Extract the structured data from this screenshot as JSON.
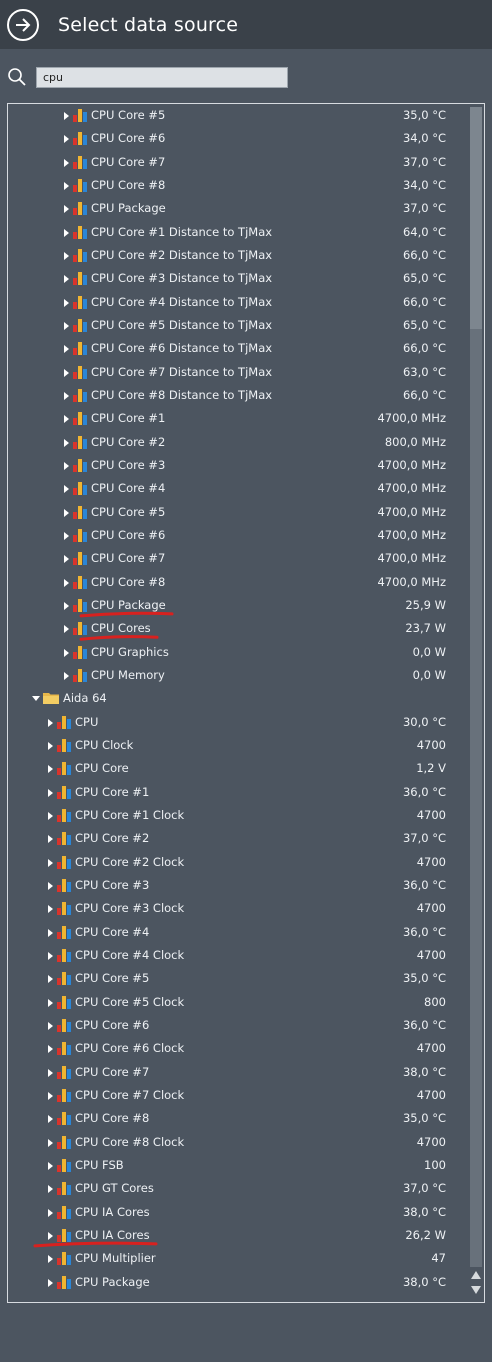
{
  "header": {
    "title": "Select data source",
    "back_icon": "arrow-right-circle-icon"
  },
  "search": {
    "value": "cpu",
    "icon": "search-icon"
  },
  "colors": {
    "background": "#4c5560",
    "header": "#3a4149",
    "annotation": "#d8211f"
  },
  "tree": {
    "rows": [
      {
        "level": 2,
        "kind": "sensor",
        "label": "CPU Core #5",
        "value": "35,0 °C"
      },
      {
        "level": 2,
        "kind": "sensor",
        "label": "CPU Core #6",
        "value": "34,0 °C"
      },
      {
        "level": 2,
        "kind": "sensor",
        "label": "CPU Core #7",
        "value": "37,0 °C"
      },
      {
        "level": 2,
        "kind": "sensor",
        "label": "CPU Core #8",
        "value": "34,0 °C"
      },
      {
        "level": 2,
        "kind": "sensor",
        "label": "CPU Package",
        "value": "37,0 °C"
      },
      {
        "level": 2,
        "kind": "sensor",
        "label": "CPU Core #1 Distance to TjMax",
        "value": "64,0 °C"
      },
      {
        "level": 2,
        "kind": "sensor",
        "label": "CPU Core #2 Distance to TjMax",
        "value": "66,0 °C"
      },
      {
        "level": 2,
        "kind": "sensor",
        "label": "CPU Core #3 Distance to TjMax",
        "value": "65,0 °C"
      },
      {
        "level": 2,
        "kind": "sensor",
        "label": "CPU Core #4 Distance to TjMax",
        "value": "66,0 °C"
      },
      {
        "level": 2,
        "kind": "sensor",
        "label": "CPU Core #5 Distance to TjMax",
        "value": "65,0 °C"
      },
      {
        "level": 2,
        "kind": "sensor",
        "label": "CPU Core #6 Distance to TjMax",
        "value": "66,0 °C"
      },
      {
        "level": 2,
        "kind": "sensor",
        "label": "CPU Core #7 Distance to TjMax",
        "value": "63,0 °C"
      },
      {
        "level": 2,
        "kind": "sensor",
        "label": "CPU Core #8 Distance to TjMax",
        "value": "66,0 °C"
      },
      {
        "level": 2,
        "kind": "sensor",
        "label": "CPU Core #1",
        "value": "4700,0 MHz"
      },
      {
        "level": 2,
        "kind": "sensor",
        "label": "CPU Core #2",
        "value": "800,0 MHz"
      },
      {
        "level": 2,
        "kind": "sensor",
        "label": "CPU Core #3",
        "value": "4700,0 MHz"
      },
      {
        "level": 2,
        "kind": "sensor",
        "label": "CPU Core #4",
        "value": "4700,0 MHz"
      },
      {
        "level": 2,
        "kind": "sensor",
        "label": "CPU Core #5",
        "value": "4700,0 MHz"
      },
      {
        "level": 2,
        "kind": "sensor",
        "label": "CPU Core #6",
        "value": "4700,0 MHz"
      },
      {
        "level": 2,
        "kind": "sensor",
        "label": "CPU Core #7",
        "value": "4700,0 MHz"
      },
      {
        "level": 2,
        "kind": "sensor",
        "label": "CPU Core #8",
        "value": "4700,0 MHz"
      },
      {
        "level": 2,
        "kind": "sensor",
        "label": "CPU Package",
        "value": "25,9 W",
        "underlined": true
      },
      {
        "level": 2,
        "kind": "sensor",
        "label": "CPU Cores",
        "value": "23,7 W",
        "underlined": true
      },
      {
        "level": 2,
        "kind": "sensor",
        "label": "CPU Graphics",
        "value": "0,0 W"
      },
      {
        "level": 2,
        "kind": "sensor",
        "label": "CPU Memory",
        "value": "0,0 W"
      },
      {
        "level": 0,
        "kind": "folder",
        "label": "Aida 64",
        "value": "",
        "expanded": true
      },
      {
        "level": 1,
        "kind": "sensor",
        "label": "CPU",
        "value": "30,0 °C"
      },
      {
        "level": 1,
        "kind": "sensor",
        "label": "CPU Clock",
        "value": "4700"
      },
      {
        "level": 1,
        "kind": "sensor",
        "label": "CPU Core",
        "value": "1,2 V"
      },
      {
        "level": 1,
        "kind": "sensor",
        "label": "CPU Core #1",
        "value": "36,0 °C"
      },
      {
        "level": 1,
        "kind": "sensor",
        "label": "CPU Core #1 Clock",
        "value": "4700"
      },
      {
        "level": 1,
        "kind": "sensor",
        "label": "CPU Core #2",
        "value": "37,0 °C"
      },
      {
        "level": 1,
        "kind": "sensor",
        "label": "CPU Core #2 Clock",
        "value": "4700"
      },
      {
        "level": 1,
        "kind": "sensor",
        "label": "CPU Core #3",
        "value": "36,0 °C"
      },
      {
        "level": 1,
        "kind": "sensor",
        "label": "CPU Core #3 Clock",
        "value": "4700"
      },
      {
        "level": 1,
        "kind": "sensor",
        "label": "CPU Core #4",
        "value": "36,0 °C"
      },
      {
        "level": 1,
        "kind": "sensor",
        "label": "CPU Core #4 Clock",
        "value": "4700"
      },
      {
        "level": 1,
        "kind": "sensor",
        "label": "CPU Core #5",
        "value": "35,0 °C"
      },
      {
        "level": 1,
        "kind": "sensor",
        "label": "CPU Core #5 Clock",
        "value": "800"
      },
      {
        "level": 1,
        "kind": "sensor",
        "label": "CPU Core #6",
        "value": "36,0 °C"
      },
      {
        "level": 1,
        "kind": "sensor",
        "label": "CPU Core #6 Clock",
        "value": "4700"
      },
      {
        "level": 1,
        "kind": "sensor",
        "label": "CPU Core #7",
        "value": "38,0 °C"
      },
      {
        "level": 1,
        "kind": "sensor",
        "label": "CPU Core #7 Clock",
        "value": "4700"
      },
      {
        "level": 1,
        "kind": "sensor",
        "label": "CPU Core #8",
        "value": "35,0 °C"
      },
      {
        "level": 1,
        "kind": "sensor",
        "label": "CPU Core #8 Clock",
        "value": "4700"
      },
      {
        "level": 1,
        "kind": "sensor",
        "label": "CPU FSB",
        "value": "100"
      },
      {
        "level": 1,
        "kind": "sensor",
        "label": "CPU GT Cores",
        "value": "37,0 °C"
      },
      {
        "level": 1,
        "kind": "sensor",
        "label": "CPU IA Cores",
        "value": "38,0 °C"
      },
      {
        "level": 1,
        "kind": "sensor",
        "label": "CPU IA Cores",
        "value": "26,2 W",
        "underlined": true
      },
      {
        "level": 1,
        "kind": "sensor",
        "label": "CPU Multiplier",
        "value": "47"
      },
      {
        "level": 1,
        "kind": "sensor",
        "label": "CPU Package",
        "value": "38,0 °C"
      }
    ]
  },
  "scrollbar": {
    "position_fraction": 0.0
  }
}
